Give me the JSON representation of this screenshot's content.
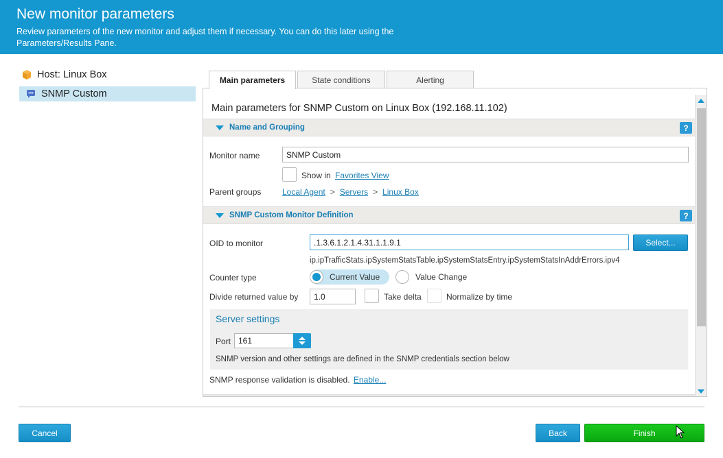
{
  "header": {
    "title": "New monitor parameters",
    "subtitle": "Review parameters of the new monitor and adjust them if necessary. You can do this later using the Parameters/Results Pane."
  },
  "tree": {
    "host_label": "Host: Linux Box",
    "monitor_label": "SNMP Custom",
    "host_icon": "box-icon",
    "monitor_icon": "chat-bubble-icon"
  },
  "tabs": [
    {
      "label": "Main parameters",
      "active": true
    },
    {
      "label": "State conditions",
      "active": false
    },
    {
      "label": "Alerting",
      "active": false
    }
  ],
  "panel": {
    "title": "Main parameters for SNMP Custom on Linux Box (192.168.11.102)",
    "name_grouping": {
      "heading": "Name and Grouping",
      "help": "?",
      "monitor_name_label": "Monitor name",
      "monitor_name_value": "SNMP Custom",
      "show_in_label": "Show in",
      "favorites_link": "Favorites View",
      "parent_groups_label": "Parent groups",
      "parent_groups": [
        "Local Agent",
        "Servers",
        "Linux Box"
      ],
      "separator": ">"
    },
    "definition": {
      "heading": "SNMP Custom Monitor Definition",
      "help": "?",
      "oid_label": "OID to monitor",
      "oid_value": ".1.3.6.1.2.1.4.31.1.1.9.1",
      "select_button": "Select...",
      "oid_name": "ip.ipTrafficStats.ipSystemStatsTable.ipSystemStatsEntry.ipSystemStatsInAddrErrors.ipv4",
      "counter_type_label": "Counter type",
      "counter_options": [
        "Current Value",
        "Value Change"
      ],
      "counter_selected": "Current Value",
      "divide_label": "Divide returned value by",
      "divide_value": "1.0",
      "take_delta_label": "Take delta",
      "normalize_label": "Normalize by time",
      "server_settings": {
        "title": "Server settings",
        "port_label": "Port",
        "port_value": "161",
        "note": "SNMP version and other settings are defined in the SNMP credentials section below"
      },
      "validation_text": "SNMP response validation is disabled.",
      "enable_link": "Enable..."
    }
  },
  "footer": {
    "cancel": "Cancel",
    "back": "Back",
    "finish": "Finish"
  },
  "colors": {
    "header_bg": "#1597cf",
    "accent": "#1a7fb5",
    "finish_green": "#0aa80f",
    "selected_row": "#cbe6f3"
  }
}
